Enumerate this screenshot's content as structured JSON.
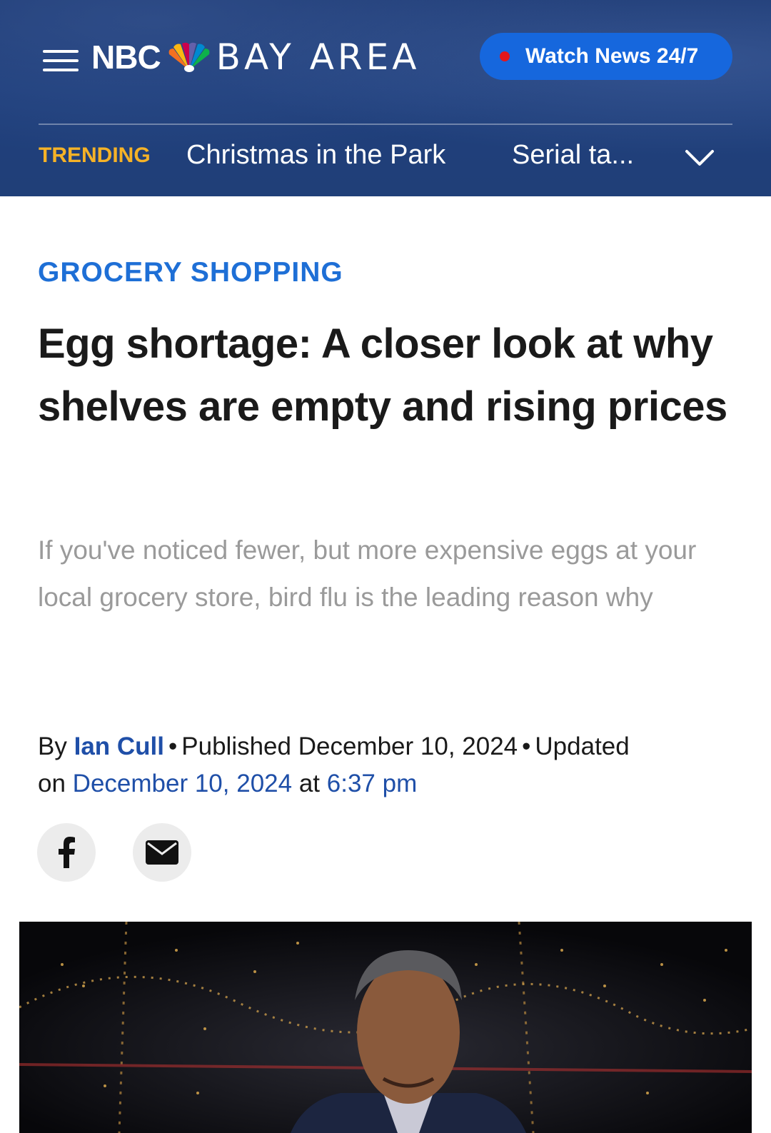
{
  "header": {
    "logo_nbc": "NBC",
    "logo_area": "BAY AREA",
    "watch_label": "Watch News 24/7",
    "trending_label": "TRENDING",
    "trending_items": [
      "Christmas in the Park",
      "Serial ta..."
    ]
  },
  "article": {
    "category": "GROCERY SHOPPING",
    "headline": "Egg shortage: A closer look at why shelves are empty and rising prices",
    "dek": "If you've noticed fewer, but more expensive eggs at your local grocery store, bird flu is the leading reason why",
    "byline": {
      "by": "By",
      "author": "Ian Cull",
      "published_label": "Published December 10, 2024",
      "updated_label": "Updated",
      "on": "on",
      "updated_date": "December 10, 2024",
      "at": "at",
      "updated_time": "6:37 pm"
    }
  },
  "colors": {
    "header_bg": "#1f3f7c",
    "watch_button": "#1667dd",
    "live_dot": "#e3161c",
    "trending": "#f5b227",
    "category": "#1e6fd6",
    "link": "#1f4fa8"
  },
  "icons": [
    "menu-icon",
    "nbc-peacock-logo",
    "live-dot-icon",
    "chevron-down-icon",
    "facebook-icon",
    "email-icon"
  ]
}
